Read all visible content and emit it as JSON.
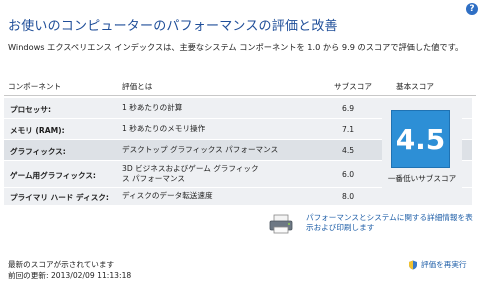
{
  "header": {
    "title": "お使いのコンピューターのパフォーマンスの評価と改善",
    "subtitle": "Windows エクスペリエンス インデックスは、主要なシステム コンポーネントを 1.0 から 9.9 のスコアで評価した値です。"
  },
  "table": {
    "col_component": "コンポーネント",
    "col_description": "評価とは",
    "col_subscore": "サブスコア",
    "col_basescore": "基本スコア",
    "rows": [
      {
        "component": "プロセッサ:",
        "description": "1 秒あたりの計算",
        "subscore": "6.9"
      },
      {
        "component": "メモリ (RAM):",
        "description": "1 秒あたりのメモリ操作",
        "subscore": "7.1"
      },
      {
        "component": "グラフィックス:",
        "description": "デスクトップ グラフィックス パフォーマンス",
        "subscore": "4.5"
      },
      {
        "component": "ゲーム用グラフィックス:",
        "description": "3D ビジネスおよびゲーム グラフィックス パフォーマンス",
        "subscore": "6.0"
      },
      {
        "component": "プライマリ ハード ディスク:",
        "description": "ディスクのデータ転送速度",
        "subscore": "8.0"
      }
    ]
  },
  "base_score": {
    "value": "4.5",
    "caption": "一番低いサブスコア",
    "color": "#2d8fd6"
  },
  "links": {
    "details": "パフォーマンスとシステムに関する詳細情報を表示および印刷します",
    "rerun": "評価を再実行"
  },
  "footer": {
    "status": "最新のスコアが示されています",
    "last_updated": "前回の更新: 2013/02/09 11:13:18"
  },
  "icons": [
    "help-icon",
    "printer-icon",
    "shield-icon"
  ]
}
